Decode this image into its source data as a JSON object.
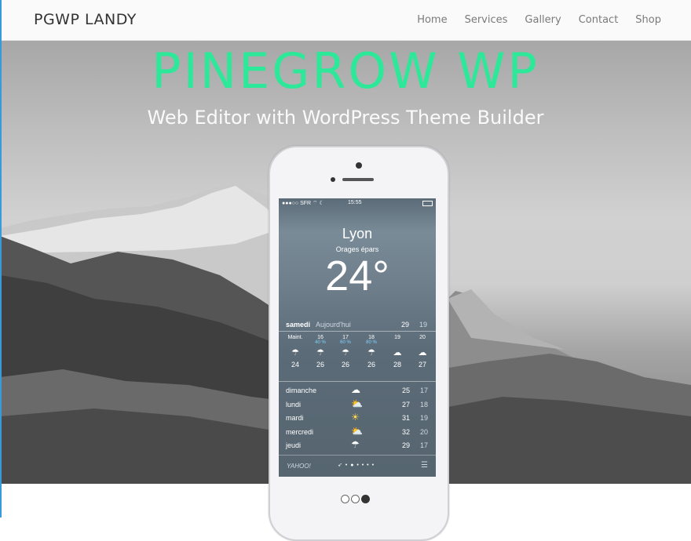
{
  "header": {
    "brand": "PGWP LANDY",
    "nav": [
      "Home",
      "Services",
      "Gallery",
      "Contact",
      "Shop"
    ]
  },
  "hero": {
    "title": "PINEGROW WP",
    "subtitle": "Web Editor with WordPress Theme Builder",
    "title_color": "#2ee89a"
  },
  "phone": {
    "status": {
      "carrier": "●●●○○ SFR ⌔ ☾",
      "time": "15:55"
    },
    "city": "Lyon",
    "condition": "Orages épars",
    "temperature": "24°",
    "today": {
      "day": "samedi",
      "label": "Aujourd'hui",
      "high": "29",
      "low": "19"
    },
    "hourly": [
      {
        "time": "Maint.",
        "pct": "",
        "icon": "rain-cloud-icon",
        "glyph": "☂",
        "temp": "24"
      },
      {
        "time": "16",
        "pct": "40 %",
        "icon": "rain-cloud-icon",
        "glyph": "☂",
        "temp": "26"
      },
      {
        "time": "17",
        "pct": "60 %",
        "icon": "rain-cloud-icon",
        "glyph": "☂",
        "temp": "26"
      },
      {
        "time": "18",
        "pct": "80 %",
        "icon": "rain-cloud-icon",
        "glyph": "☂",
        "temp": "26"
      },
      {
        "time": "19",
        "pct": "",
        "icon": "cloud-icon",
        "glyph": "☁",
        "temp": "28"
      },
      {
        "time": "20",
        "pct": "",
        "icon": "cloud-icon",
        "glyph": "☁",
        "temp": "27"
      }
    ],
    "daily": [
      {
        "day": "dimanche",
        "icon": "cloud-icon",
        "glyph": "☁",
        "high": "25",
        "low": "17"
      },
      {
        "day": "lundi",
        "icon": "partly-sunny-icon",
        "glyph": "⛅",
        "high": "27",
        "low": "18"
      },
      {
        "day": "mardi",
        "icon": "sun-icon",
        "glyph": "☀",
        "high": "31",
        "low": "19"
      },
      {
        "day": "mercredi",
        "icon": "partly-sunny-icon",
        "glyph": "⛅",
        "high": "32",
        "low": "20"
      },
      {
        "day": "jeudi",
        "icon": "rain-cloud-icon",
        "glyph": "☂",
        "high": "29",
        "low": "17"
      }
    ],
    "footer": {
      "brand": "YAHOO!",
      "dots": "➶ • ● • • • •",
      "menu_glyph": "☰"
    }
  },
  "slider": {
    "count": 3,
    "active": 2
  }
}
